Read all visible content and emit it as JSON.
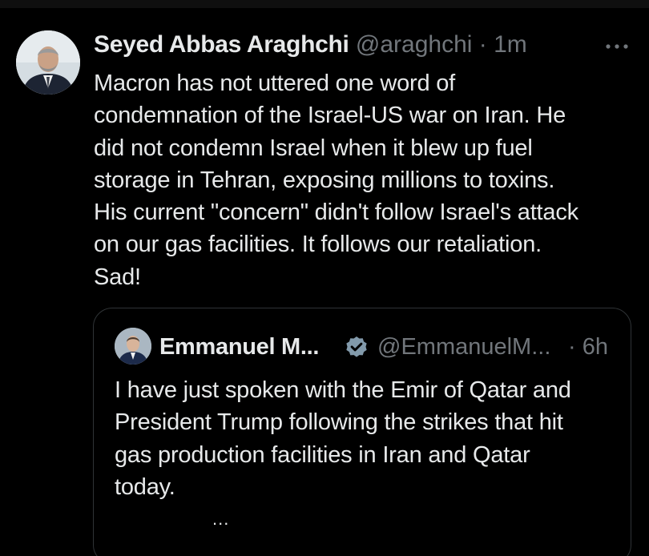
{
  "tweet": {
    "display_name": "Seyed Abbas Araghchi",
    "handle": "@araghchi",
    "separator": "·",
    "time": "1m",
    "text": "Macron has not uttered one word of\ncondemnation of the Israel-US war on Iran. He\ndid not condemn Israel when it blew up fuel\nstorage in Tehran, exposing millions to toxins.\nHis current \"concern\" didn't follow Israel's attack\non our gas facilities. It follows our retaliation.\nSad!",
    "more_icon": "more-horizontal-icon"
  },
  "quote": {
    "display_name": "Emmanuel M...",
    "handle": "@EmmanuelM...",
    "separator": "·",
    "time": "6h",
    "verified_icon": "verified-badge-icon",
    "text": "I have just spoken with the Emir of Qatar and\nPresident Trump following the strikes that hit\ngas production facilities in Iran and Qatar\ntoday.",
    "truncation": "..."
  },
  "colors": {
    "background": "#000000",
    "text": "#e7e9ea",
    "secondary_text": "#71767b",
    "border": "#2f3336",
    "verified": "#829aab"
  }
}
